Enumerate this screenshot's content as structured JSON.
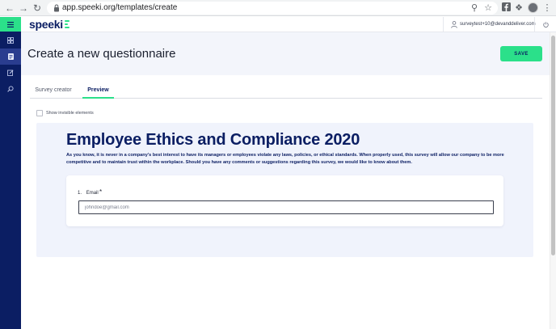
{
  "browser": {
    "url": "app.speeki.org/templates/create"
  },
  "app": {
    "logo_text": "speeki",
    "user_email": "surveytest+10@devanddeliver.com"
  },
  "page": {
    "title": "Create a new questionnaire",
    "save_label": "SAVE"
  },
  "tabs": [
    {
      "label": "Survey creator",
      "active": false
    },
    {
      "label": "Preview",
      "active": true
    }
  ],
  "options": {
    "show_invisible_label": "Show invisible elements",
    "show_invisible_checked": false
  },
  "survey": {
    "title": "Employee Ethics and Compliance 2020",
    "description": "As you know, it is never in a company's best interest to have its managers or employees violate any laws, policies, or ethical standards. When properly used, this survey will allow our company to be more competitive and to maintain trust within the workplace. Should you have any comments or suggestions regarding this survey, we would like to know about them.",
    "questions": [
      {
        "number": "1.",
        "label": "Email",
        "required_marker": "*",
        "placeholder": "johndoe@gmail.com"
      }
    ]
  },
  "colors": {
    "accent": "#2be08a",
    "brand": "#0b1e63",
    "panel_bg": "#f0f3fc"
  },
  "icons": {
    "sidebar": [
      "menu-icon",
      "dashboard-icon",
      "templates-icon",
      "edit-icon",
      "search-icon"
    ]
  }
}
